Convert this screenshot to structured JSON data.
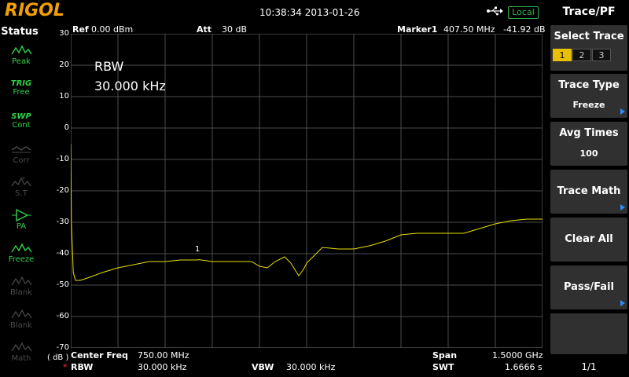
{
  "header": {
    "brand": "RIGOL",
    "datetime": "10:38:34 2013-01-26",
    "usb_icon": "usb-icon",
    "local_badge": "Local"
  },
  "status_panel": {
    "title": "Status",
    "items": [
      {
        "icon": "peak-icon",
        "top": "",
        "label": "Peak",
        "state": "active"
      },
      {
        "icon": "",
        "top": "TRIG",
        "label": "Free",
        "state": "active"
      },
      {
        "icon": "",
        "top": "SWP",
        "label": "Cont",
        "state": "active"
      },
      {
        "icon": "corr-icon",
        "top": "",
        "label": "Corr",
        "state": "inactive"
      },
      {
        "icon": "st-icon",
        "top": "",
        "label": "S.T",
        "state": "inactive"
      },
      {
        "icon": "pa-icon",
        "top": "",
        "label": "PA",
        "state": "active"
      },
      {
        "icon": "freeze-icon",
        "top": "",
        "label": "Freeze",
        "state": "active"
      },
      {
        "icon": "blank-icon",
        "top": "",
        "label": "Blank",
        "state": "inactive"
      },
      {
        "icon": "blank-icon",
        "top": "",
        "label": "Blank",
        "state": "inactive"
      },
      {
        "icon": "math-icon",
        "top": "",
        "label": "Math",
        "state": "inactive"
      }
    ]
  },
  "plot_header": {
    "ref_label": "Ref",
    "ref_value": "0.00 dBm",
    "att_label": "Att",
    "att_value": "30 dB",
    "marker_label": "Marker1",
    "marker_freq": "407.50 MHz",
    "marker_level": "-41.92 dB"
  },
  "annotation": {
    "line1": "RBW",
    "line2": "30.000 kHz"
  },
  "marker_number": "1",
  "y_axis": {
    "unit": "( dB )",
    "ticks": [
      "30",
      "20",
      "10",
      "0",
      "-10",
      "-20",
      "-30",
      "-40",
      "-50",
      "-60",
      "-70"
    ]
  },
  "footer": {
    "center_label": "Center Freq",
    "center_value": "750.00 MHz",
    "span_label": "Span",
    "span_value": "1.5000 GHz",
    "rbw_mark": "*",
    "rbw_label": "RBW",
    "rbw_value": "30.000 kHz",
    "vbw_label": "VBW",
    "vbw_value": "30.000 kHz",
    "swt_label": "SWT",
    "swt_value": "1.6666 s"
  },
  "menu": {
    "title": "Trace/PF",
    "select_trace": {
      "label": "Select Trace",
      "options": [
        "1",
        "2",
        "3"
      ],
      "selected": "1"
    },
    "trace_type": {
      "label": "Trace Type",
      "value": "Freeze"
    },
    "avg_times": {
      "label": "Avg Times",
      "value": "100"
    },
    "trace_math": {
      "label": "Trace Math"
    },
    "clear_all": {
      "label": "Clear All"
    },
    "pass_fail": {
      "label": "Pass/Fail"
    },
    "page_indicator": "1/1"
  },
  "colors": {
    "trace": "#e8e000",
    "grid": "#4d4d4d",
    "brand": "#f2a000",
    "status_active": "#2fd04a",
    "accent_arrow": "#2a8cff"
  },
  "chart_data": {
    "type": "line",
    "xlabel": "",
    "ylabel": "",
    "x_unit": "MHz",
    "xlim": [
      0,
      1500
    ],
    "ylim": [
      -70,
      30
    ],
    "grid": true,
    "series": [
      {
        "x": [
          0,
          2,
          8,
          15,
          30,
          60,
          100,
          150,
          200,
          250,
          300,
          350,
          400,
          407.5,
          450,
          500,
          550,
          575,
          600,
          625,
          650,
          680,
          700,
          712,
          725,
          740,
          750,
          800,
          850,
          900,
          950,
          1000,
          1050,
          1100,
          1150,
          1200,
          1250,
          1300,
          1350,
          1400,
          1450,
          1500
        ],
        "y": [
          -5,
          -30,
          -46,
          -48.5,
          -48.5,
          -47.5,
          -46,
          -44.5,
          -43.5,
          -42.5,
          -42.5,
          -42,
          -42,
          -41.9,
          -42.5,
          -42.5,
          -42.5,
          -42.5,
          -44,
          -44.5,
          -42.5,
          -41,
          -43,
          -45,
          -47,
          -45,
          -43,
          -38,
          -38.5,
          -38.5,
          -37.5,
          -36,
          -34,
          -33.5,
          -33.5,
          -33.5,
          -33.5,
          -32,
          -30.5,
          -29.5,
          -29,
          -29
        ]
      }
    ]
  }
}
